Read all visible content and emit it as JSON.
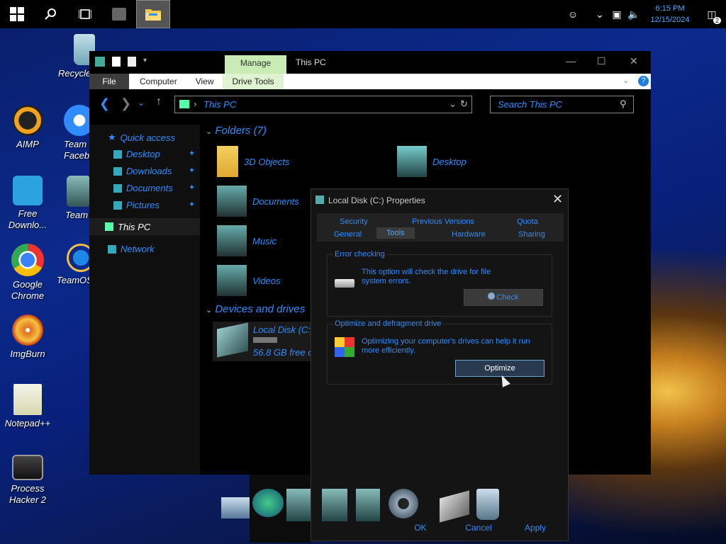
{
  "taskbar": {
    "clock_time": "6:15 PM",
    "clock_date": "12/15/2024",
    "notification_count": "2"
  },
  "desktop_icons": [
    {
      "label": "Recycle",
      "icon": "recycle-bin-icon"
    },
    {
      "label": "AIMP",
      "icon": "aimp-icon"
    },
    {
      "label": "Team",
      "label2": "Faceb",
      "icon": "gear-icon"
    },
    {
      "label": "Free",
      "label2": "Downlo...",
      "icon": "free-download-icon"
    },
    {
      "label": "Team",
      "icon": "windows-icon"
    },
    {
      "label": "Google",
      "label2": "Chrome",
      "icon": "chrome-icon"
    },
    {
      "label": "TeamOS",
      "icon": "internet-explorer-icon"
    },
    {
      "label": "ImgBurn",
      "icon": "imgburn-icon"
    },
    {
      "label": "Notepad++",
      "icon": "notepad-plus-icon"
    },
    {
      "label": "Process",
      "label2": "Hacker 2",
      "icon": "process-hacker-icon"
    }
  ],
  "explorer": {
    "contextual_tab": "Manage",
    "title": "This PC",
    "ribbon_tabs": [
      "File",
      "Computer",
      "View",
      "Drive Tools"
    ],
    "address": "This PC",
    "search_placeholder": "Search This PC",
    "nav": {
      "quick_access": "Quick access",
      "pinned": [
        "Desktop",
        "Downloads",
        "Documents",
        "Pictures"
      ],
      "this_pc": "This PC",
      "network": "Network"
    },
    "folders_header": "Folders (7)",
    "folders": [
      "3D Objects",
      "Desktop",
      "Documents",
      "Music",
      "Videos"
    ],
    "devices_header": "Devices and drives",
    "drive": {
      "name": "Local Disk (C:)",
      "free": "56.8 GB free o"
    }
  },
  "dialog": {
    "title": "Local Disk (C:) Properties",
    "tabs_row1": [
      "Security",
      "Previous Versions",
      "Quota"
    ],
    "tabs_row2": [
      "General",
      "Tools",
      "Hardware",
      "Sharing"
    ],
    "error_checking": {
      "title": "Error checking",
      "text": "This option will check the drive for file system errors.",
      "button": "Check"
    },
    "optimize": {
      "title": "Optimize and defragment drive",
      "text": "Optimizing your computer's drives can help it run more efficiently.",
      "button": "Optimize"
    },
    "footer": [
      "OK",
      "Cancel",
      "Apply"
    ]
  },
  "colors": {
    "accent": "#2f8cff",
    "manage_tab": "#c8ecb4",
    "window_bg": "#000000"
  }
}
